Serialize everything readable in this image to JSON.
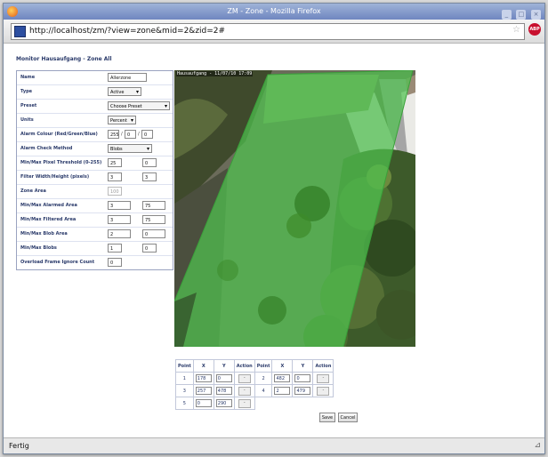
{
  "window": {
    "title": "ZM - Zone - Mozilla Firefox",
    "controls": [
      "_",
      "□",
      "×"
    ]
  },
  "navbar": {
    "url": "http://localhost/zm/?view=zone&mid=2&zid=2#",
    "adblock_label": "ABP"
  },
  "page": {
    "title": "Monitor Hausaufgang - Zone All"
  },
  "form": {
    "name": {
      "label": "Name",
      "value": "Allerzone"
    },
    "type": {
      "label": "Type",
      "value": "Active"
    },
    "preset": {
      "label": "Preset",
      "value": "Choose Preset"
    },
    "units": {
      "label": "Units",
      "value": "Percent"
    },
    "alarm_colour": {
      "label": "Alarm Colour (Red/Green/Blue)",
      "r": "255",
      "g": "0",
      "b": "0",
      "sep": "/"
    },
    "check_method": {
      "label": "Alarm Check Method",
      "value": "Blobs"
    },
    "pixel_thresh": {
      "label": "Min/Max Pixel Threshold (0-255)",
      "min": "25",
      "max": "0"
    },
    "filter_size": {
      "label": "Filter Width/Height (pixels)",
      "w": "3",
      "h": "3"
    },
    "zone_area": {
      "label": "Zone Area",
      "value": "100"
    },
    "alarmed_area": {
      "label": "Min/Max Alarmed Area",
      "min": "3",
      "max": "75"
    },
    "filtered_area": {
      "label": "Min/Max Filtered Area",
      "min": "3",
      "max": "75"
    },
    "blob_area": {
      "label": "Min/Max Blob Area",
      "min": "2",
      "max": "0"
    },
    "blobs": {
      "label": "Min/Max Blobs",
      "min": "1",
      "max": "0"
    },
    "overload": {
      "label": "Overload Frame Ignore Count",
      "value": "0"
    }
  },
  "camera": {
    "timestamp_label": "Hausaufgang - 11/07/10 17:09"
  },
  "points": {
    "headers": [
      "Point",
      "X",
      "Y",
      "Action",
      "Point",
      "X",
      "Y",
      "Action"
    ],
    "rows": [
      {
        "p1": "1",
        "x1": "178",
        "y1": "0",
        "a1": "-",
        "p2": "2",
        "x2": "482",
        "y2": "0",
        "a2": "-"
      },
      {
        "p1": "3",
        "x1": "257",
        "y1": "478",
        "a1": "-",
        "p2": "4",
        "x2": "2",
        "y2": "479",
        "a2": "-"
      },
      {
        "p1": "5",
        "x1": "0",
        "y1": "290",
        "a1": "-"
      }
    ]
  },
  "buttons": {
    "save": "Save",
    "cancel": "Cancel"
  },
  "status": {
    "text": "Fertig"
  },
  "colors": {
    "zone_overlay": "#4fc24f",
    "label_text": "#2a3a6a",
    "title_bar": "#7f95c9"
  }
}
